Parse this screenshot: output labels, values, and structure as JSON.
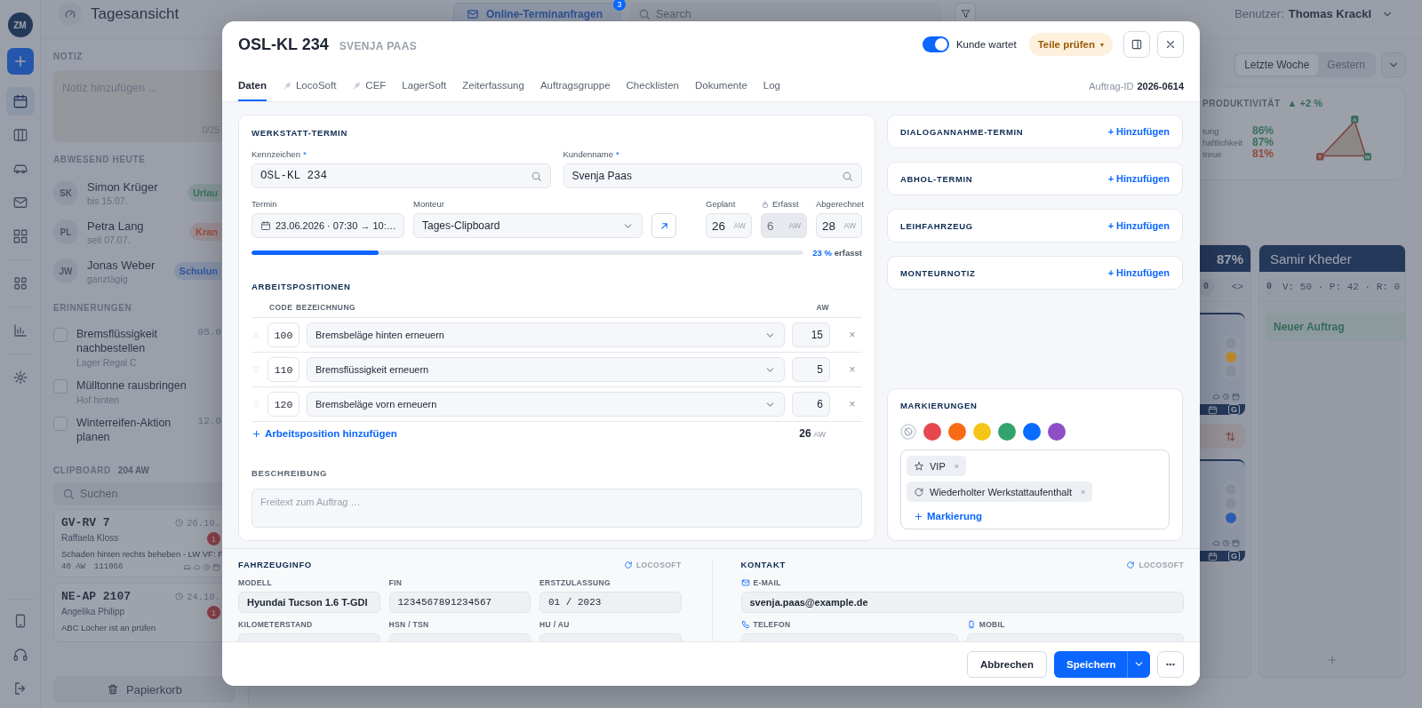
{
  "sidebar": {
    "avatar": "ZM",
    "items": [
      {
        "kind": "calendar",
        "selected": true
      },
      {
        "kind": "columns",
        "selected": false
      },
      {
        "kind": "car",
        "selected": false
      },
      {
        "kind": "mail",
        "selected": false
      },
      {
        "kind": "qr",
        "selected": false
      },
      {
        "kind": "apps",
        "selected": false
      },
      {
        "kind": "chart",
        "selected": false
      },
      {
        "kind": "settings",
        "selected": false
      }
    ],
    "bottom_items": [
      {
        "kind": "tablet"
      },
      {
        "kind": "headset"
      },
      {
        "kind": "logout"
      }
    ]
  },
  "header": {
    "title": "Tagesansicht",
    "request_tab": {
      "label": "Online-Terminanfragen",
      "badge": "3"
    },
    "search": {
      "placeholder": "Search"
    },
    "user_label": "Benutzer:",
    "user_name": "Thomas Krackl"
  },
  "left_panel": {
    "note": {
      "title": "NOTIZ",
      "placeholder": "Notiz hinzufügen ...",
      "counter": "0/25"
    },
    "absent": {
      "title": "ABWESEND HEUTE",
      "people": [
        {
          "initials": "SK",
          "name": "Simon Krüger",
          "detail": "bis 15.07.",
          "badge": "Urlau",
          "color": "#3a6f5a"
        },
        {
          "initials": "PL",
          "name": "Petra Lang",
          "detail": "seit 07.07.",
          "badge": "Kran",
          "color": "#94493b"
        },
        {
          "initials": "JW",
          "name": "Jonas Weber",
          "detail": "ganztägig",
          "badge": "Schulun",
          "color": "#2f5597"
        }
      ]
    },
    "reminders": {
      "title": "ERINNERUNGEN",
      "items": [
        {
          "text": "Bremsflüssigkeit nachbestellen",
          "detail": "Lager Regal C",
          "date": "05.0",
          "checked": false
        },
        {
          "text": "Mülltonne rausbringen",
          "detail": "Hof hinten",
          "checked": false
        },
        {
          "text": "Winterreifen-Aktion planen",
          "date": "12.0",
          "checked": false
        }
      ]
    },
    "clipboard": {
      "title": "CLIPBOARD",
      "total": "204 AW",
      "search_placeholder": "Suchen",
      "cards": [
        {
          "plate": "GV-RV 7",
          "customer": "Raffaela Kloss",
          "date": "26.10.",
          "badge": "1",
          "description": "Schaden hinten rechts beheben - LW VF: F",
          "aw": "40 AW",
          "number": "111066"
        },
        {
          "plate": "NE-AP 2107",
          "customer": "Angelika Philipp",
          "date": "24.10.",
          "badge": "1",
          "description": "ABC Löcher ist an prüfen"
        }
      ]
    },
    "trash": "Papierkorb"
  },
  "dashboard": {
    "range_tabs": [
      {
        "label": "Letzte Woche",
        "selected": true
      },
      {
        "label": "Gestern",
        "selected": false
      }
    ],
    "productivity": {
      "title": "PRODUKTIVITÄT",
      "trend": "▲ +2 %",
      "metrics": [
        {
          "label": "tung",
          "value": "86%",
          "color": "#3a6f5a"
        },
        {
          "label": "haftlichkeit",
          "value": "87%",
          "color": "#3a6f5a"
        },
        {
          "label": "treue",
          "value": "81%",
          "color": "#94493b"
        }
      ],
      "radar_labels": [
        "A",
        "T",
        "W"
      ]
    },
    "board": [
      {
        "kind": "cards",
        "title": "87%",
        "count": "0",
        "action": "<>",
        "cards": [
          {
            "lamps": [
              {
                "on": false
              },
              {
                "on": true
              },
              {
                "on": false
              }
            ],
            "color": "#b8862a",
            "tag": "G"
          },
          {
            "lamps": [
              {
                "on": false
              },
              {
                "on": false
              },
              {
                "on": true
              }
            ],
            "color": "#2f5bb0",
            "tag": "G"
          }
        ]
      },
      {
        "kind": "empty",
        "title": "Samir Kheder",
        "count": "0",
        "stats": "V: 50 · P: 42 · R: 0",
        "new_order": "Neuer Auftrag"
      }
    ]
  },
  "dialog": {
    "title": "OSL-KL 234",
    "subtitle": "SVENJA PAAS",
    "waiting_toggle": {
      "label": "Kunde wartet",
      "on": true
    },
    "parts_button": {
      "label": "Teile prüfen",
      "caret": "▾"
    },
    "tabs": [
      {
        "label": "Daten",
        "selected": true,
        "linked": false
      },
      {
        "label": "LocoSoft",
        "selected": false,
        "linked": true
      },
      {
        "label": "CEF",
        "selected": false,
        "linked": true
      },
      {
        "label": "LagerSoft",
        "selected": false,
        "linked": false
      },
      {
        "label": "Zeiterfassung",
        "selected": false,
        "linked": false
      },
      {
        "label": "Auftragsgruppe",
        "selected": false,
        "linked": false
      },
      {
        "label": "Checklisten",
        "selected": false,
        "linked": false
      },
      {
        "label": "Dokumente",
        "selected": false,
        "linked": false
      },
      {
        "label": "Log",
        "selected": false,
        "linked": false
      }
    ],
    "order_id_label": "Auftrag-ID",
    "order_id": "2026-0614",
    "appointment": {
      "title": "WERKSTATT-TERMIN",
      "plate": {
        "label": "Kennzeichen",
        "required": "*",
        "value": "OSL-KL 234"
      },
      "customer": {
        "label": "Kundenname",
        "required": "*",
        "value": "Svenja Paas"
      },
      "date": {
        "label": "Termin",
        "value": "23.06.2026 · 07:30 → 10:…"
      },
      "mechanic": {
        "label": "Monteur",
        "value": "Tages-Clipboard"
      },
      "hours": [
        {
          "label": "Geplant",
          "value": "26",
          "unit": "AW",
          "locked": false
        },
        {
          "label": "Erfasst",
          "value": "6",
          "unit": "AW",
          "locked": true
        },
        {
          "label": "Abgerechnet",
          "value": "28",
          "unit": "AW",
          "locked": false
        }
      ],
      "progress": {
        "level": 0.23,
        "percent": "23 %",
        "label": "erfasst"
      }
    },
    "positions": {
      "title": "ARBEITSPOSITIONEN",
      "columns": [
        "CODE",
        "BEZEICHNUNG",
        "AW"
      ],
      "rows": [
        {
          "code": "100",
          "description": "Bremsbeläge hinten erneuern",
          "aw": "15",
          "remove": "×"
        },
        {
          "code": "110",
          "description": "Bremsflüssigkeit erneuern",
          "aw": "5",
          "remove": "×"
        },
        {
          "code": "120",
          "description": "Bremsbeläge vorn erneuern",
          "aw": "6",
          "remove": "×"
        }
      ],
      "add": "Arbeitsposition hinzufügen",
      "total": "26",
      "total_unit": "AW"
    },
    "description": {
      "title": "BESCHREIBUNG",
      "placeholder": "Freitext zum Auftrag …"
    },
    "side_cards": [
      {
        "title": "DIALOGANNAHME-TERMIN",
        "action": "+ Hinzufügen"
      },
      {
        "title": "ABHOL-TERMIN",
        "action": "+ Hinzufügen"
      },
      {
        "title": "LEIHFAHRZEUG",
        "action": "+ Hinzufügen"
      },
      {
        "title": "MONTEURNOTIZ",
        "action": "+ Hinzufügen"
      }
    ],
    "markings": {
      "title": "MARKIERUNGEN",
      "swatches": [
        {
          "kind": "none",
          "selected": true
        },
        {
          "kind": "color",
          "color": "#e5484d",
          "selected": false
        },
        {
          "kind": "color",
          "color": "#f76b15",
          "selected": false
        },
        {
          "kind": "color",
          "color": "#f5c518",
          "selected": false
        },
        {
          "kind": "color",
          "color": "#30a46c",
          "selected": false
        },
        {
          "kind": "color",
          "color": "#0a6cff",
          "selected": false
        },
        {
          "kind": "color",
          "color": "#8e4ec6",
          "selected": false
        }
      ],
      "tags": [
        {
          "kind": "star",
          "label": "VIP",
          "remove": "×"
        },
        {
          "kind": "repeat",
          "label": "Wiederholter Werkstattaufenthalt",
          "remove": "×"
        }
      ],
      "add": "Markierung"
    },
    "vehicle": {
      "title": "FAHRZEUGINFO",
      "source": "LOCOSOFT",
      "fields": [
        {
          "label": "MODELL",
          "value": "Hyundai Tucson 1.6 T-GDI",
          "kind": "text"
        },
        {
          "label": "FIN",
          "value": "1234567891234567",
          "kind": "code"
        },
        {
          "label": "ERSTZULASSUNG",
          "value": "01 / 2023",
          "kind": "code"
        },
        {
          "label": "KILOMETERSTAND",
          "kind": "text"
        },
        {
          "label": "HSN / TSN",
          "kind": "code"
        },
        {
          "label": "HU / AU",
          "kind": "code"
        }
      ]
    },
    "contact": {
      "title": "KONTAKT",
      "source": "LOCOSOFT",
      "fields": [
        {
          "kind": "mail",
          "label": "E-MAIL",
          "value": "svenja.paas@example.de"
        },
        {
          "kind": "phone",
          "label": "TELEFON"
        },
        {
          "kind": "mobile",
          "label": "MOBIL"
        }
      ]
    },
    "footer": {
      "cancel": "Abbrechen",
      "save": "Speichern"
    }
  }
}
